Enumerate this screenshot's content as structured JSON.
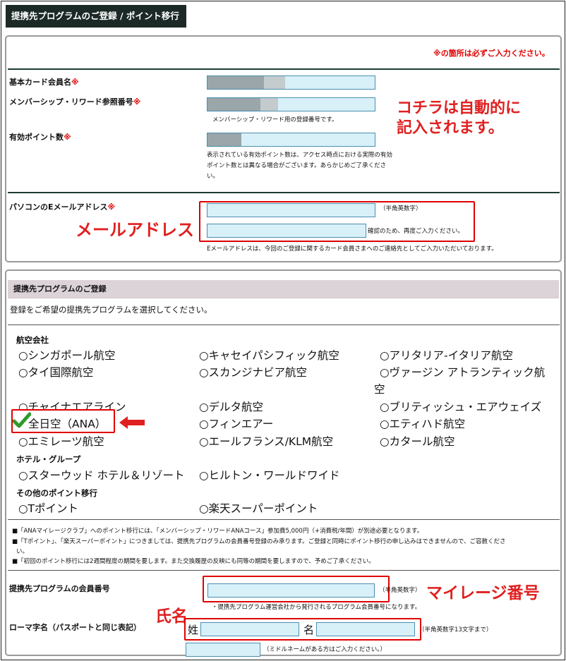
{
  "page_title": "提携先プログラムのご登録 / ポイント移行",
  "required_note": "※の箇所は必ずご入力ください。",
  "required_mark": "※",
  "fields": {
    "member_name": {
      "label": "基本カード会員名"
    },
    "membership_no": {
      "label": "メンバーシップ・リワード参照番号",
      "hint": "メンバーシップ・リワード用の登録番号です。"
    },
    "points": {
      "label": "有効ポイント数",
      "hint_lines": [
        "表示されている有効ポイント数は、アクセス時点における実際の有効",
        "ポイント数とは異なる場合がございます。あらかじめご了承くださ",
        "い。"
      ]
    },
    "email": {
      "label": "パソコンのEメールアドレス",
      "suffix1": "（半角英数字）",
      "suffix2": "確認のため、再度ご入力ください。",
      "hint": "Eメールアドレスは、今回のご登録に関するカード会員さまへのご連絡先としてご入力いただいております。"
    }
  },
  "annotations": {
    "auto_fill_line1": "コチラは自動的に",
    "auto_fill_line2": "記入されます。",
    "email": "メールアドレス",
    "mileage_no": "マイレージ番号",
    "name": "氏名"
  },
  "program_section": {
    "heading": "提携先プログラムのご登録",
    "instruction": "登録をご希望の提携先プログラムを選択してください。",
    "groups": [
      {
        "title": "航空会社",
        "options": [
          "○シンガポール航空",
          "○キャセイパシフィック航空",
          "○アリタリア-イタリア航空",
          "○タイ国際航空",
          "○スカンジナビア航空",
          "○ヴァージン アトランティック航",
          "○チャイナエアライン",
          "○デルタ航空",
          "○ブリティッシュ・エアウェイズ",
          "全日空（ANA）",
          "○フィンエアー",
          "○エティハド航空",
          "○エミレーツ航空",
          "○エールフランス/KLM航空",
          "○カタール航空"
        ],
        "wrap_tail": "空"
      },
      {
        "title": "ホテル・グループ",
        "options": [
          "○スターウッド ホテル＆リゾート",
          "○ヒルトン・ワールドワイド"
        ]
      },
      {
        "title": "その他のポイント移行",
        "options": [
          "○Tポイント",
          "○楽天スーパーポイント"
        ]
      }
    ],
    "selected": "全日空（ANA）",
    "notes": [
      "■「ANAマイレージクラブ」へのポイント移行には、「メンバーシップ・リワードANAコース」参加費5,000円（+消費税/年間）が別途必要となります。",
      "■「Tポイント」、「楽天スーパーポイント」につきましては、提携先プログラムの会員番号登録のみ承ります。ご登録と同時にポイント移行の申し込みはできませんので、ご容赦くださ",
      "い。",
      "■「初回のポイント移行には2週間程度の期間を要します。また交換履歴の反映にも同等の期間を要しますので、予めご了承ください。"
    ],
    "member_no": {
      "label": "提携先プログラムの会員番号",
      "suffix": "（半角英数字）",
      "hint": "・提携先プログラム運営会社から発行されるプログラム会員番号になります。"
    },
    "roman_name": {
      "label": "ローマ字名（パスポートと同じ表記）",
      "last_label": "姓",
      "first_label": "名",
      "suffix": "（半角英数字13文字まで）",
      "middle_hint": "（ミドルネームがある方はご入力ください。）"
    }
  },
  "colors": {
    "title_bg": "#1b2a26",
    "required": "#e00000",
    "field_bg": "#d8f0f8",
    "section_bg": "#dcd3d8"
  }
}
